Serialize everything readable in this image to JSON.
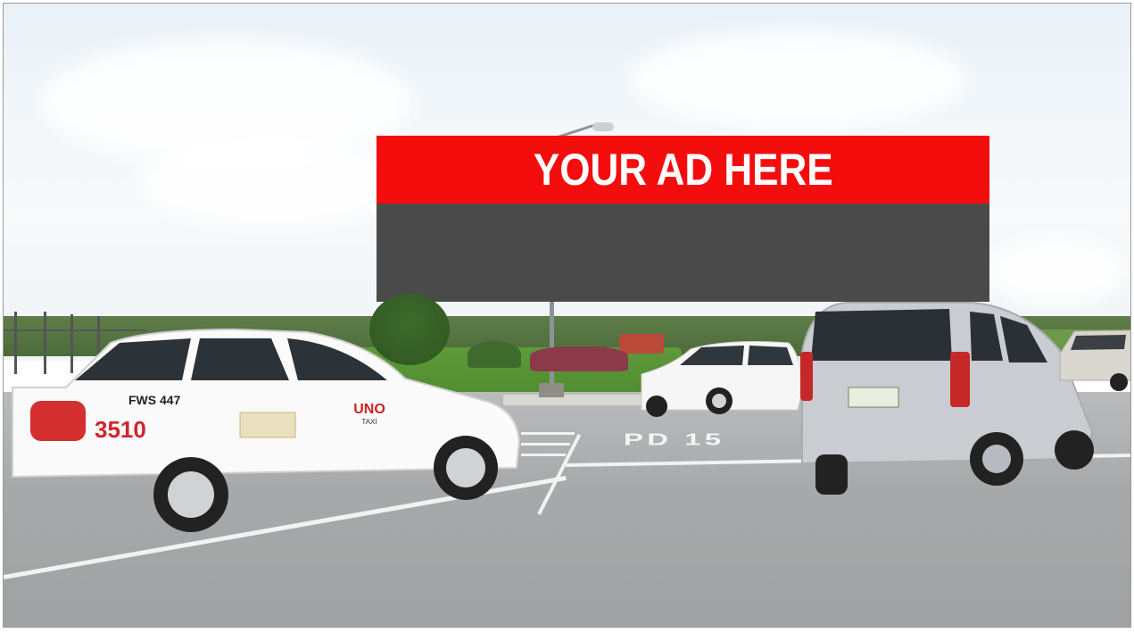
{
  "billboard": {
    "headline": "YOUR AD HERE",
    "header_color": "#f40d0d",
    "panel_color": "#4a4a4a"
  },
  "taxi": {
    "body_number": "3510",
    "plate": "FWS 447",
    "brand": "UNO",
    "brand_sub": "TAXI"
  },
  "road_marking": "PD 15"
}
